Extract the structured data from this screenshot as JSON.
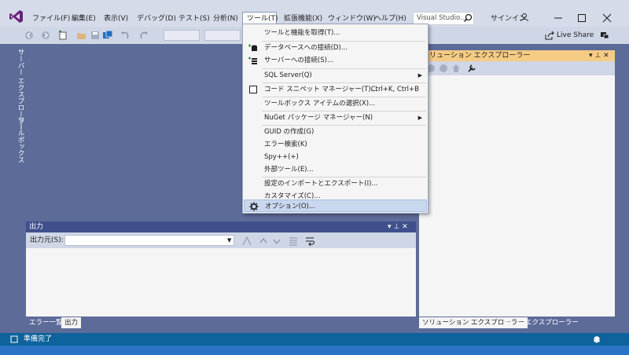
{
  "menubar": {
    "items": [
      "ファイル(F)",
      "編集(E)",
      "表示(V)",
      "デバッグ(D)",
      "テスト(S)",
      "分析(N)",
      "ツール(T)",
      "拡張機能(X)",
      "ウィンドウ(W)",
      "ヘルプ(H)"
    ],
    "active": "ツール(T)"
  },
  "search": {
    "placeholder": "Visual Studio..."
  },
  "signin": "サインイン",
  "toolbar": {
    "liveshare": "Live Share"
  },
  "side_tabs": [
    "サーバー エクスプローラー",
    "ツールボックス"
  ],
  "tools_menu": {
    "items": [
      {
        "label": "ツールと機能を取得(T)...",
        "shortcut": ""
      },
      {
        "label": "データベースへの接続(D)...",
        "shortcut": ""
      },
      {
        "label": "サーバーへの接続(S)...",
        "shortcut": ""
      },
      {
        "label": "SQL Server(Q)",
        "shortcut": ""
      },
      {
        "label": "コード スニペット マネージャー(T)...",
        "shortcut": "Ctrl+K, Ctrl+B"
      },
      {
        "label": "ツールボックス アイテムの選択(X)...",
        "shortcut": ""
      },
      {
        "label": "NuGet パッケージ マネージャー(N)",
        "shortcut": ""
      },
      {
        "label": "GUID の作成(G)",
        "shortcut": ""
      },
      {
        "label": "エラー検索(K)",
        "shortcut": ""
      },
      {
        "label": "Spy++(+)",
        "shortcut": ""
      },
      {
        "label": "外部ツール(E)...",
        "shortcut": ""
      },
      {
        "label": "設定のインポートとエクスポート(I)...",
        "shortcut": ""
      },
      {
        "label": "カスタマイズ(C)...",
        "shortcut": ""
      },
      {
        "label": "オプション(O)...",
        "shortcut": ""
      }
    ]
  },
  "solution_explorer": {
    "title": "ソリューション エクスプローラー"
  },
  "output_panel": {
    "title": "出力",
    "source_label": "出力元(S):"
  },
  "bottom_tabs_left": [
    "エラー一覧",
    "出力"
  ],
  "bottom_tabs_right": [
    "ソリューション エクスプローラー",
    "チーム エクスプローラー"
  ],
  "status": {
    "text": "準備完了"
  },
  "colors": {
    "accent_purple": "#68217a",
    "statusbar": "#0e639c",
    "panel_highlight": "#f5cc84"
  }
}
